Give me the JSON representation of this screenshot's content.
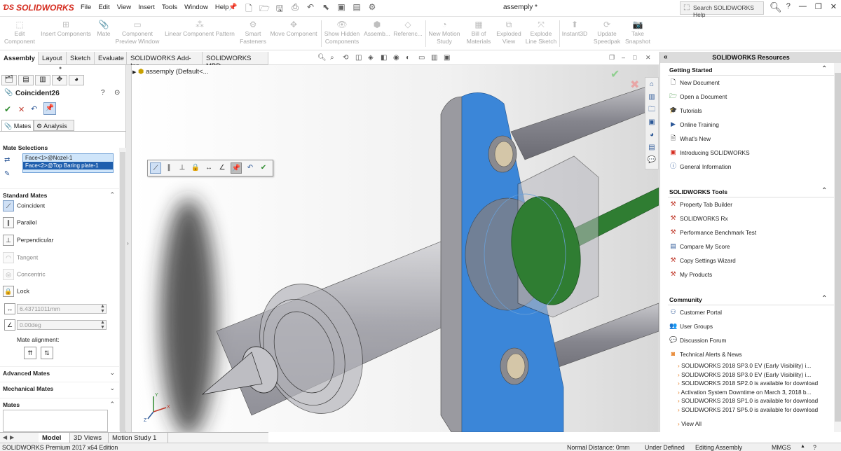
{
  "app": {
    "brand": "SOLIDWORKS",
    "document_title": "assemply *",
    "search_placeholder": "Search SOLIDWORKS Help"
  },
  "menu": [
    "File",
    "Edit",
    "View",
    "Insert",
    "Tools",
    "Window",
    "Help"
  ],
  "commands": [
    {
      "label": "Edit\nComponent",
      "icon": "edit-component-icon"
    },
    {
      "label": "Insert Components",
      "icon": "insert-components-icon"
    },
    {
      "label": "Mate",
      "icon": "mate-icon"
    },
    {
      "label": "Component\nPreview Window",
      "icon": "preview-window-icon"
    },
    {
      "label": "Linear Component Pattern",
      "icon": "linear-pattern-icon"
    },
    {
      "label": "Smart\nFasteners",
      "icon": "smart-fasteners-icon"
    },
    {
      "label": "Move Component",
      "icon": "move-component-icon"
    },
    {
      "label": "Show Hidden\nComponents",
      "icon": "show-hidden-icon"
    },
    {
      "label": "Assemb...",
      "icon": "assembly-features-icon"
    },
    {
      "label": "Referenc...",
      "icon": "reference-geometry-icon"
    },
    {
      "label": "New Motion\nStudy",
      "icon": "motion-study-icon"
    },
    {
      "label": "Bill of\nMaterials",
      "icon": "bom-icon"
    },
    {
      "label": "Exploded\nView",
      "icon": "exploded-view-icon"
    },
    {
      "label": "Explode\nLine Sketch",
      "icon": "explode-line-icon"
    },
    {
      "label": "Instant3D",
      "icon": "instant3d-icon"
    },
    {
      "label": "Update\nSpeedpak",
      "icon": "speedpak-icon"
    },
    {
      "label": "Take\nSnapshot",
      "icon": "snapshot-icon"
    }
  ],
  "tabs": [
    "Assembly",
    "Layout",
    "Sketch",
    "Evaluate",
    "SOLIDWORKS Add-Ins",
    "SOLIDWORKS MBD"
  ],
  "property_manager": {
    "title": "Coincident26",
    "subtabs": [
      "Mates",
      "Analysis"
    ],
    "mate_selections_label": "Mate Selections",
    "selections": [
      "Face<1>@Nozel-1",
      "Face<2>@Top Baring plate-1"
    ],
    "standard_mates_label": "Standard Mates",
    "mates": [
      {
        "label": "Coincident",
        "enabled": true
      },
      {
        "label": "Parallel",
        "enabled": true
      },
      {
        "label": "Perpendicular",
        "enabled": true
      },
      {
        "label": "Tangent",
        "enabled": false
      },
      {
        "label": "Concentric",
        "enabled": false
      },
      {
        "label": "Lock",
        "enabled": true
      }
    ],
    "distance_value": "6.43711011mm",
    "angle_value": "0.00deg",
    "mate_alignment_label": "Mate alignment:",
    "advanced_mates_label": "Advanced Mates",
    "mechanical_mates_label": "Mechanical Mates",
    "mates_list_label": "Mates"
  },
  "tree": {
    "root": "assemply  (Default<..."
  },
  "bottom_tabs": [
    "Model",
    "3D Views",
    "Motion Study 1"
  ],
  "resources": {
    "header": "SOLIDWORKS Resources",
    "getting_started": {
      "title": "Getting Started",
      "items": [
        "New Document",
        "Open a Document",
        "Tutorials",
        "Online Training",
        "What's New",
        "Introducing SOLIDWORKS",
        "General Information"
      ]
    },
    "tools": {
      "title": "SOLIDWORKS Tools",
      "items": [
        "Property Tab Builder",
        "SOLIDWORKS Rx",
        "Performance Benchmark Test",
        "Compare My Score",
        "Copy Settings Wizard",
        "My Products"
      ]
    },
    "community": {
      "title": "Community",
      "items": [
        "Customer Portal",
        "User Groups",
        "Discussion Forum",
        "Technical Alerts & News"
      ]
    },
    "news": [
      "SOLIDWORKS 2018 SP3.0 EV (Early Visibility) i...",
      "SOLIDWORKS 2018 SP3.0 EV (Early Visibility) i...",
      "SOLIDWORKS 2018 SP2.0 is available for download",
      "Activation System Downtime on March 3, 2018 b...",
      "SOLIDWORKS 2018 SP1.0 is available for download",
      "SOLIDWORKS 2017 SP5.0 is available for download"
    ],
    "view_all": "View All"
  },
  "status": {
    "edition": "SOLIDWORKS Premium 2017 x64 Edition",
    "distance": "Normal Distance: 0mm",
    "state": "Under Defined",
    "mode": "Editing Assembly",
    "units": "MMGS"
  },
  "colors": {
    "accent_blue": "#3b86d8",
    "selection_green": "#2f7d32",
    "brand_red": "#d52b1e",
    "highlight": "#1f5fae"
  }
}
